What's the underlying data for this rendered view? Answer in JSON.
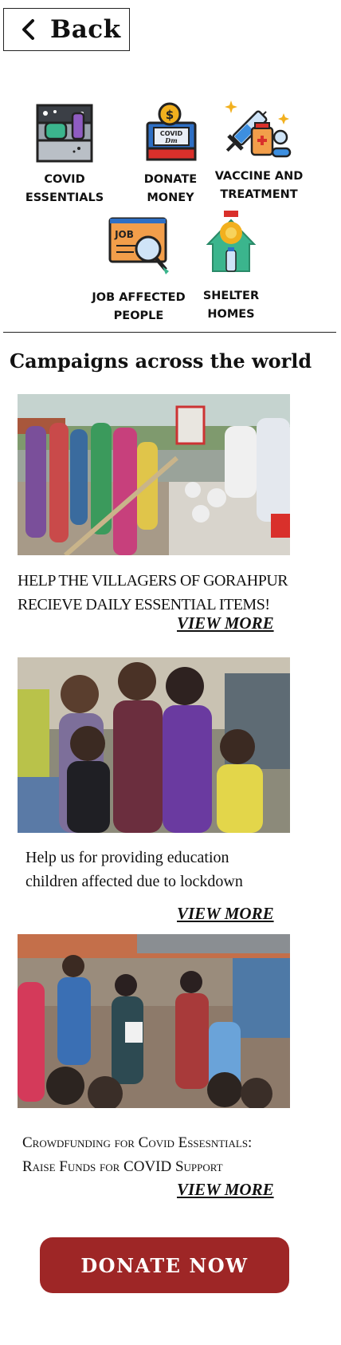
{
  "header": {
    "back_label": "Back"
  },
  "categories": [
    {
      "label": "COVID\nESSENTIALS"
    },
    {
      "label": "DONATE\nMONEY"
    },
    {
      "label": "VACCINE AND\nTREATMENT"
    },
    {
      "label": "JOB AFFECTED\nPEOPLE"
    },
    {
      "label": "SHELTER\nHOMES"
    }
  ],
  "section": {
    "title": "Campaigns across the world"
  },
  "campaigns": [
    {
      "title": "HELP  THE VILLAGERS OF GORAHPUR\nRECIEVE DAILY ESSENTIAL  ITEMS!",
      "view_more": "VIEW MORE"
    },
    {
      "title": "Help us for providing education\nchildren affected due to lockdown",
      "view_more": "VIEW MORE"
    },
    {
      "title": "Crowdfunding for Covid Essesntials:\nRaise Funds for COVID Support",
      "view_more": "VIEW MORE"
    }
  ],
  "donate": {
    "label": "DONATE  NOW"
  },
  "colors": {
    "donate_bg": "#9e2626",
    "text": "#111111"
  },
  "icons": [
    "chevron-left-icon",
    "essentials-kit-icon",
    "donation-box-icon",
    "vaccine-icon",
    "job-search-icon",
    "shelter-home-icon"
  ]
}
